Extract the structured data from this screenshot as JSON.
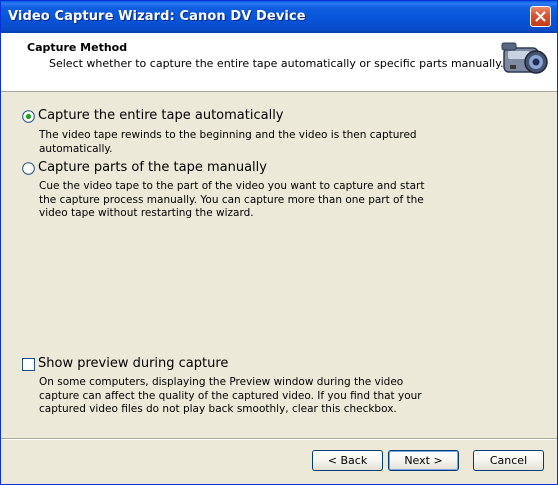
{
  "window": {
    "title": "Video Capture Wizard: Canon DV Device"
  },
  "header": {
    "title": "Capture Method",
    "subtitle": "Select whether to capture the entire tape automatically or specific parts manually.",
    "icon": "camcorder-icon"
  },
  "options": {
    "auto": {
      "label": "Capture the entire tape automatically",
      "selected": true,
      "description": "The video tape rewinds to the beginning and the video is then captured automatically."
    },
    "manual": {
      "label": "Capture parts of the tape manually",
      "selected": false,
      "description": "Cue the video tape to the part of the video you want to capture and start the capture process manually. You can capture more than one part of the video tape without restarting the wizard."
    }
  },
  "preview": {
    "label": "Show preview during capture",
    "checked": false,
    "description": "On some computers, displaying the Preview window during the video capture can affect the quality of the captured video. If you find that your captured video files do not play back smoothly, clear this checkbox."
  },
  "buttons": {
    "back": "< Back",
    "next": "Next >",
    "cancel": "Cancel"
  }
}
